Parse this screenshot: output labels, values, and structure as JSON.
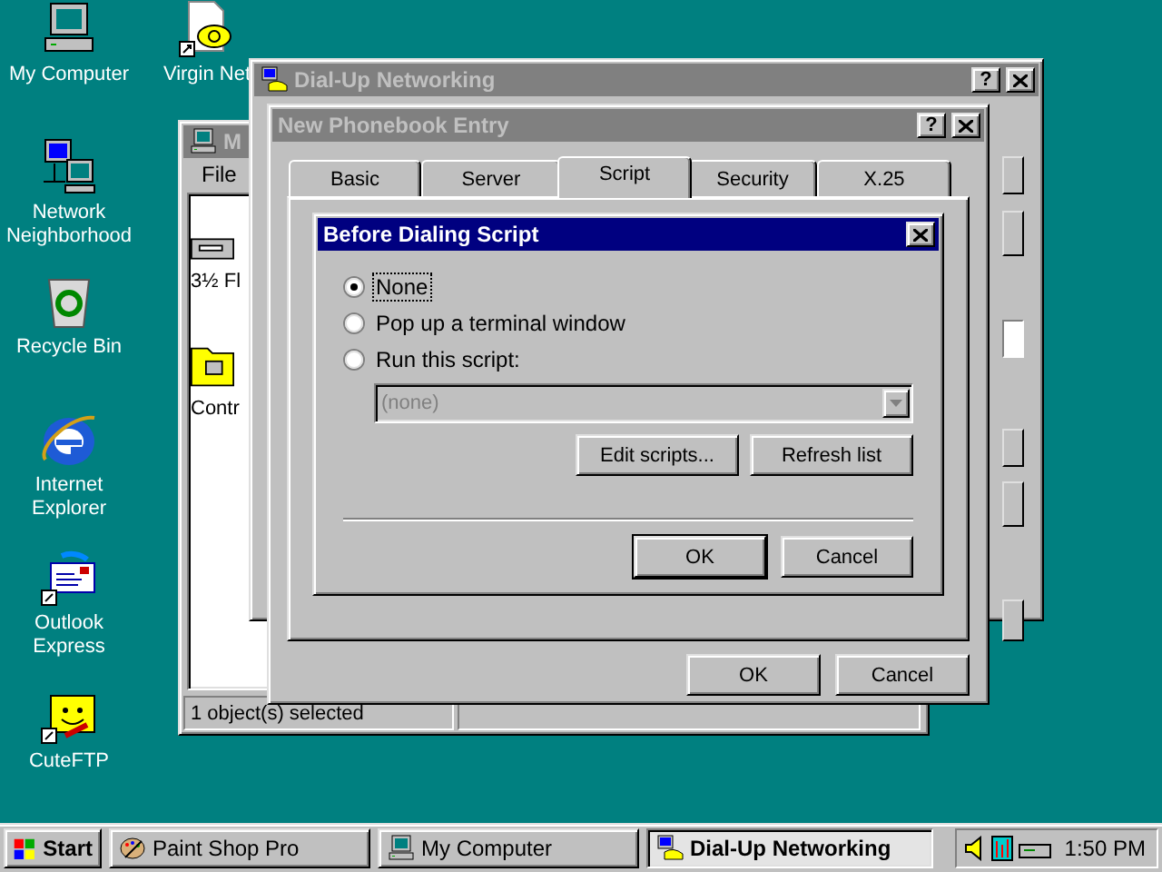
{
  "desktop_icons": [
    {
      "label": "My Computer",
      "kind": "computer"
    },
    {
      "label": "Virgin Net",
      "kind": "phone"
    },
    {
      "label": "Network Neighborhood",
      "kind": "network"
    },
    {
      "label": "Recycle Bin",
      "kind": "bin"
    },
    {
      "label": "Internet Explorer",
      "kind": "ie"
    },
    {
      "label": "Outlook Express",
      "kind": "mail"
    },
    {
      "label": "CuteFTP",
      "kind": "ftp"
    }
  ],
  "explorer_window": {
    "title": "M",
    "active": false,
    "menu": [
      {
        "label": "File"
      }
    ],
    "items": [
      {
        "label": "3½ Fl",
        "kind": "floppy"
      },
      {
        "label": "Contr",
        "kind": "folder"
      }
    ],
    "status": "1 object(s) selected"
  },
  "dialup_window": {
    "title": "Dial-Up Networking",
    "active": false,
    "help_button": "?"
  },
  "phonebook_dialog": {
    "title": "New Phonebook Entry",
    "active": false,
    "help_button": "?",
    "tabs": [
      {
        "label": "Basic",
        "selected": false
      },
      {
        "label": "Server",
        "selected": false
      },
      {
        "label": "Script",
        "selected": true
      },
      {
        "label": "Security",
        "selected": false
      },
      {
        "label": "X.25",
        "selected": false
      }
    ],
    "buttons": [
      {
        "label": "OK"
      },
      {
        "label": "Cancel"
      }
    ]
  },
  "script_dialog": {
    "title": "Before Dialing Script",
    "active": true,
    "options": [
      {
        "label": "None",
        "selected": true,
        "focused": true
      },
      {
        "label": "Pop up a terminal window",
        "selected": false,
        "focused": false
      },
      {
        "label": "Run this script:",
        "selected": false,
        "focused": false
      }
    ],
    "script_select": {
      "value": "(none)",
      "disabled": true
    },
    "script_buttons": [
      {
        "label": "Edit scripts..."
      },
      {
        "label": "Refresh list"
      }
    ],
    "buttons": [
      {
        "label": "OK",
        "default": true
      },
      {
        "label": "Cancel",
        "default": false
      }
    ]
  },
  "taskbar": {
    "start_label": "Start",
    "tasks": [
      {
        "label": "Paint Shop Pro",
        "kind": "paint",
        "selected": false
      },
      {
        "label": "My Computer",
        "kind": "computer",
        "selected": false
      },
      {
        "label": "Dial-Up Networking",
        "kind": "dialup",
        "selected": true
      }
    ],
    "clock": "1:50 PM"
  }
}
